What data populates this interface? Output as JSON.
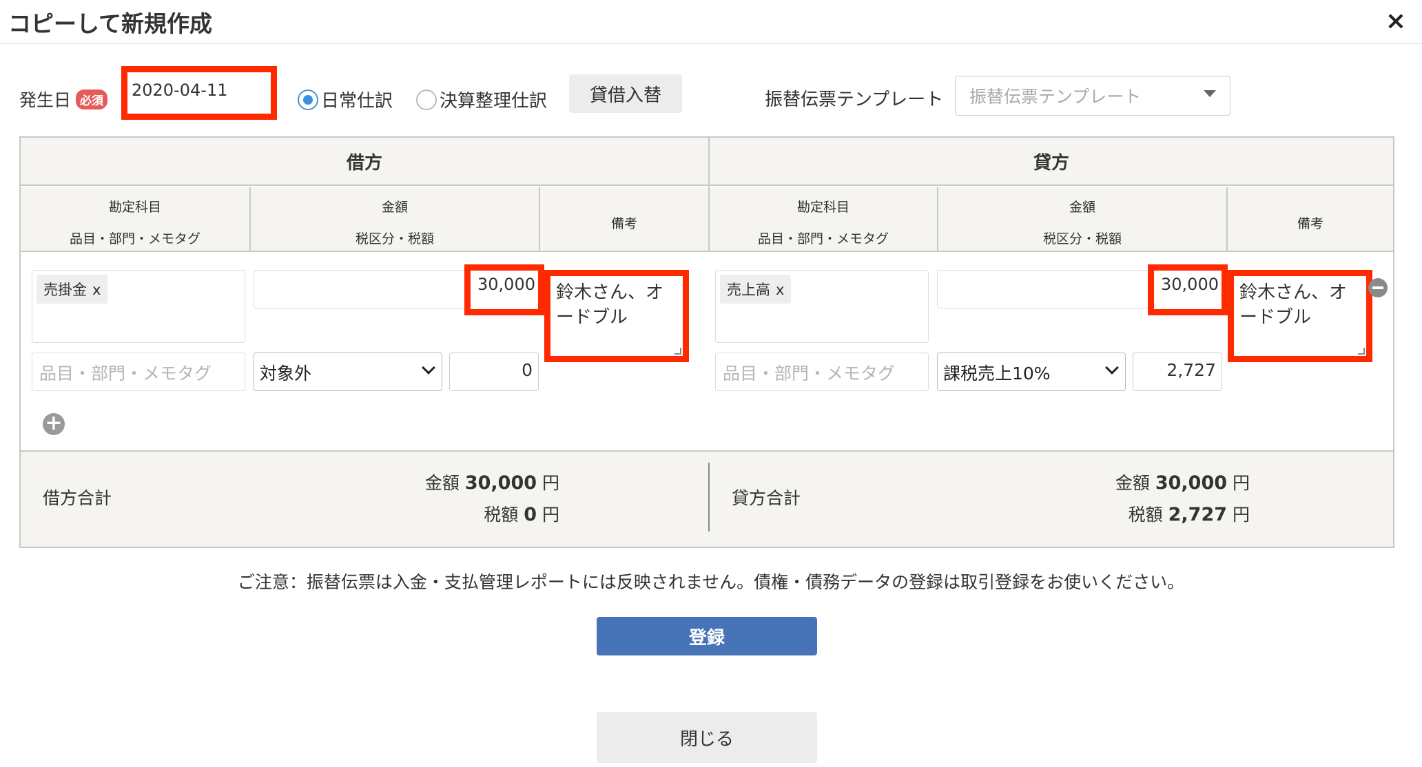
{
  "header": {
    "title": "コピーして新規作成",
    "close_icon": "×"
  },
  "form": {
    "date_label": "発生日",
    "required_badge": "必須",
    "date_value": "2020-04-11",
    "radio_normal": "日常仕訳",
    "radio_closing": "決算整理仕訳",
    "selected_radio": "日常仕訳",
    "swap_button": "貸借入替",
    "template_label": "振替伝票テンプレート",
    "template_placeholder": "振替伝票テンプレート"
  },
  "table": {
    "debit_header": "借方",
    "credit_header": "貸方",
    "columns": {
      "account_l1": "勘定科目",
      "account_l2": "品目・部門・メモタグ",
      "amount_l1": "金額",
      "amount_l2": "税区分・税額",
      "memo": "備考"
    },
    "debit": {
      "account": "売掛金",
      "remove_x": "x",
      "amount": "30,000",
      "memo": "鈴木さん、オードブル",
      "tag_placeholder": "品目・部門・メモタグ",
      "tax_category": "対象外",
      "tax_amount": "0"
    },
    "credit": {
      "account": "売上高",
      "remove_x": "x",
      "amount": "30,000",
      "memo": "鈴木さん、オードブル",
      "tag_placeholder": "品目・部門・メモタグ",
      "tax_category": "課税売上10%",
      "tax_amount": "2,727"
    },
    "add_icon": "+"
  },
  "totals": {
    "debit_label": "借方合計",
    "credit_label": "貸方合計",
    "amount_prefix": "金額",
    "tax_prefix": "税額",
    "yen": "円",
    "debit_amount": "30,000",
    "debit_tax": "0",
    "credit_amount": "30,000",
    "credit_tax": "2,727"
  },
  "footer": {
    "notice": "ご注意：振替伝票は入金・支払管理レポートには反映されません。債権・債務データの登録は取引登録をお使いください。",
    "register_button": "登録",
    "close_button": "閉じる"
  },
  "colors": {
    "accent_blue": "#4774b8",
    "highlight_red": "#ff2a00",
    "badge_red": "#e65a5a"
  }
}
